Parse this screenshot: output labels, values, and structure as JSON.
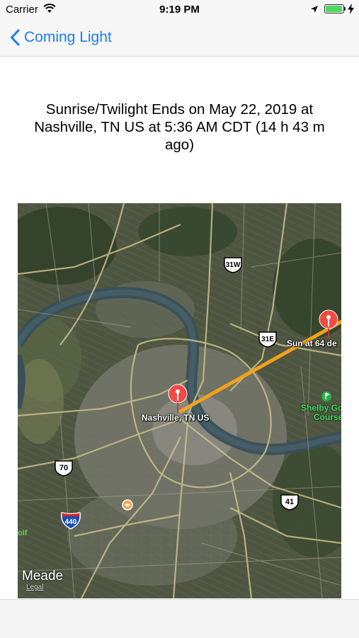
{
  "status_bar": {
    "carrier": "Carrier",
    "time": "9:19 PM",
    "battery_level": 1.0,
    "icons": [
      "wifi-icon",
      "location-arrow-icon",
      "battery-icon",
      "charging-bolt-icon"
    ]
  },
  "nav": {
    "back_label": "Coming Light",
    "accent_color": "#1a7cf5"
  },
  "headline": "Sunrise/Twilight Ends on May 22, 2019 at Nashville, TN US at 5:36 AM CDT (14 h 43 m ago)",
  "map": {
    "pins": [
      {
        "label": "Nashville, TN US"
      },
      {
        "label": "Sun at 64 de"
      }
    ],
    "route_color": "#f2a31b",
    "pin_color": "#ef4b45",
    "shields": [
      {
        "label": "31W",
        "type": "us"
      },
      {
        "label": "31E",
        "type": "us"
      },
      {
        "label": "70",
        "type": "us"
      },
      {
        "label": "41",
        "type": "us"
      },
      {
        "label": "440",
        "type": "interstate"
      }
    ],
    "park_label": "Shelby Go\nCourse",
    "place_label": "Meade",
    "partial_label": "olf",
    "legal_label": "Legal"
  }
}
